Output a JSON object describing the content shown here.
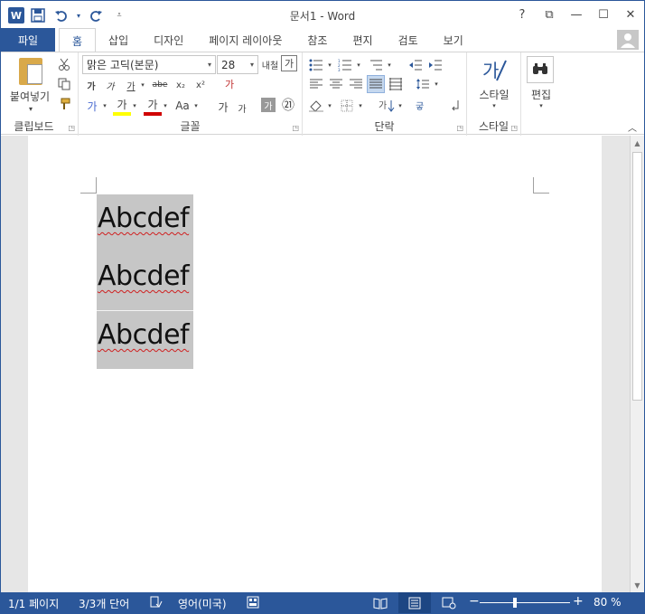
{
  "titlebar": {
    "title": "문서1 - Word",
    "qat_icons": [
      "word-icon",
      "save-icon",
      "undo-icon",
      "redo-icon",
      "customize-icon"
    ],
    "help": "?",
    "ribbon_display": "⧉",
    "minimize": "—",
    "maximize": "☐",
    "close": "✕"
  },
  "tabs": [
    "파일",
    "홈",
    "삽입",
    "디자인",
    "페이지 레이아웃",
    "참조",
    "편지",
    "검토",
    "보기"
  ],
  "ribbon": {
    "clipboard": {
      "label": "클립보드",
      "paste": "붙여넣기"
    },
    "font": {
      "label": "글꼴",
      "font_name": "맑은 고딕(본문)",
      "font_size": "28",
      "grow": "가",
      "shrink": "가",
      "bold": "가",
      "italic": "가",
      "underline": "가",
      "strike": "abe",
      "sub": "x₂",
      "sup": "x²",
      "clear": "가",
      "effects": "가",
      "highlight": "가",
      "font_color": "가",
      "case": "Aa",
      "phonetic": "가",
      "charborder": "가",
      "enclose": "㉑",
      "border_label": "내철"
    },
    "paragraph": {
      "label": "단락"
    },
    "styles": {
      "label": "스타일",
      "button": "스타일"
    },
    "editing": {
      "button": "편집"
    }
  },
  "document": {
    "lines": [
      "Abcdef",
      "Abcdef",
      "Abcdef"
    ]
  },
  "status": {
    "page": "1/1 페이지",
    "words": "3/3개 단어",
    "language": "영어(미국)",
    "zoom_minus": "−",
    "zoom_plus": "+",
    "zoom": "80 %",
    "zoom_level": 80
  },
  "colors": {
    "accent": "#2b579a",
    "selection": "#c6c6c6",
    "highlight": "#ffff00",
    "font_color": "#d00000"
  }
}
